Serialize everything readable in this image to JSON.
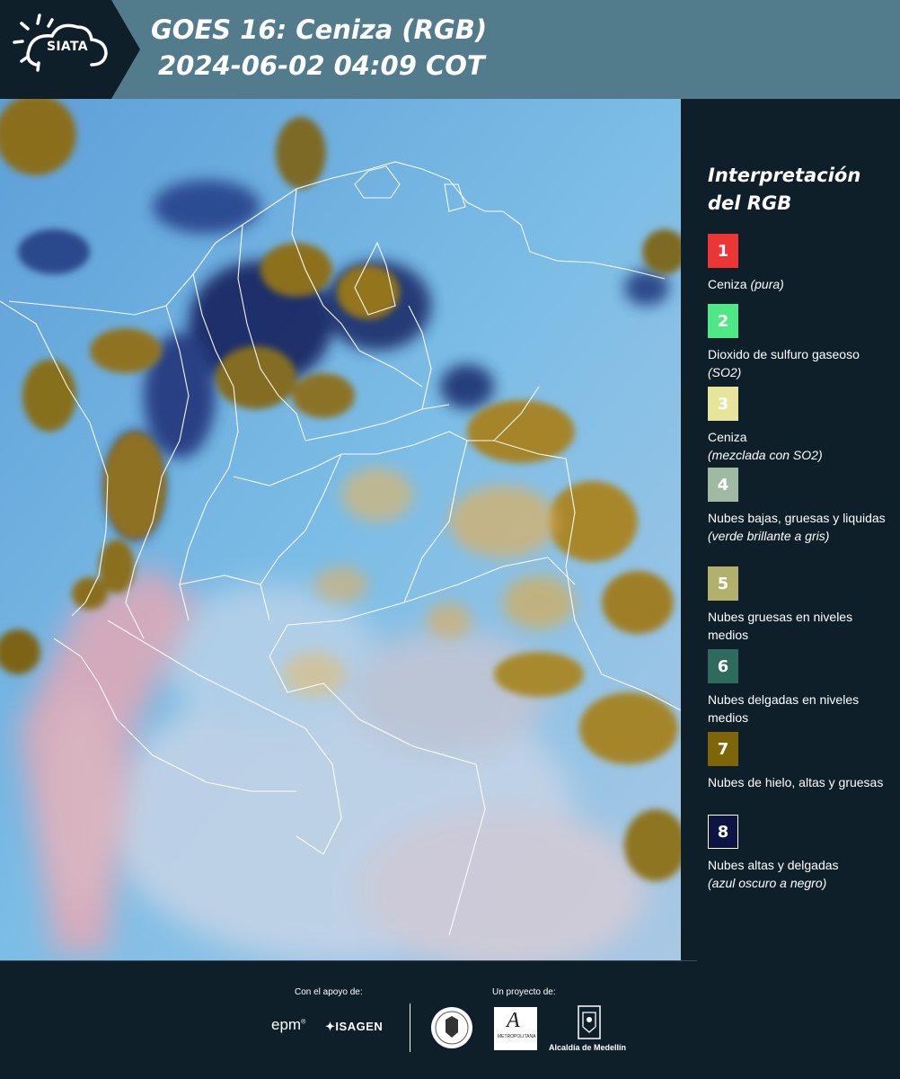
{
  "header": {
    "logo_text": "SIATA",
    "title_line1": "GOES 16: Ceniza (RGB)",
    "title_line2": "2024-06-02 04:09 COT",
    "background_color": "#527c8c"
  },
  "legend": {
    "title": "Interpretación del RGB",
    "items": [
      {
        "number": "1",
        "color": "#ec3535",
        "text": "Ceniza",
        "note": "(pura)"
      },
      {
        "number": "2",
        "color": "#4fe886",
        "text": "Dioxido de sulfuro gaseoso",
        "note": "(SO2)"
      },
      {
        "number": "3",
        "color": "#e7e59c",
        "text": "Ceniza",
        "note": "(mezclada con SO2)"
      },
      {
        "number": "4",
        "color": "#9fb9a2",
        "text": "Nubes bajas, gruesas y liquidas",
        "note": "(verde brillante a gris)"
      },
      {
        "number": "5",
        "color": "#b1b06c",
        "text": "Nubes gruesas en niveles medios",
        "note": ""
      },
      {
        "number": "6",
        "color": "#2f6b5c",
        "text": "Nubes delgadas en niveles medios",
        "note": ""
      },
      {
        "number": "7",
        "color": "#7f6509",
        "text": "Nubes de hielo, altas y gruesas",
        "note": ""
      },
      {
        "number": "8",
        "color": "#0c1446",
        "text": "Nubes altas y delgadas",
        "note": "(azul oscuro a negro)"
      }
    ]
  },
  "footer": {
    "support_caption": "Con el apoyo de:",
    "project_caption": "Un proyecto de:",
    "sponsor_logos": [
      "EPM",
      "ISAGEN"
    ],
    "project_logos": [
      "Universidad Nacional de Colombia sede Medellín",
      "Área Metropolitana Valle de Aburrá",
      "Alcaldía de Medellín"
    ],
    "epm_text": "epm",
    "isagen_text": "ISAGEN",
    "area_text": "METROPOLITANA",
    "alcaldia_text": "Alcaldía de Medellín"
  },
  "map": {
    "product": "GOES 16 Ash RGB",
    "colors": {
      "ocean_blue": "#6fb2df",
      "ice_cloud": "#8a6e20",
      "thin_high_cloud": "#1a2a6b",
      "dust_pink": "#e6a8b0",
      "borders": "#ffffff"
    }
  }
}
